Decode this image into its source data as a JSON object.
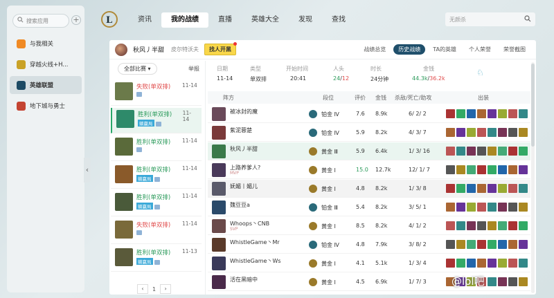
{
  "sidebar": {
    "search_placeholder": "搜索应用",
    "items": [
      {
        "label": "与我相关",
        "icon": "my-related-icon",
        "color": "#f08a24"
      },
      {
        "label": "穿越火线+H...",
        "icon": "crossfire-icon",
        "color": "#c9a227"
      },
      {
        "label": "英雄联盟",
        "icon": "lol-icon",
        "color": "#1c4a64",
        "active": true
      },
      {
        "label": "地下城与勇士",
        "icon": "dnf-icon",
        "color": "#c44432"
      }
    ]
  },
  "topnav": [
    "资讯",
    "我的战绩",
    "直播",
    "英雄大全",
    "发现",
    "查找"
  ],
  "topnav_active": 1,
  "top_search": {
    "placeholder": "无颜杀"
  },
  "profile": {
    "name": "秋风丿半甜",
    "server": "皮尔特沃夫",
    "find_button": "找人开黑",
    "tabs": [
      "战绩总览",
      "历史战绩",
      "TA的英雄",
      "个人荣誉",
      "荣誉截图"
    ],
    "active_tab": 1
  },
  "list": {
    "filter": "全部比赛",
    "sort": "举报",
    "matches": [
      {
        "result": "失败(单双排)",
        "win": false,
        "date": "11-14",
        "tag": "",
        "champ": "#6b7a4a"
      },
      {
        "result": "胜利(单双排)",
        "win": true,
        "date": "11-14",
        "tag": "躺赢局",
        "champ": "#2e8a6a",
        "active": true
      },
      {
        "result": "胜利(单双排)",
        "win": true,
        "date": "11-14",
        "tag": "",
        "champ": "#5a6a3a"
      },
      {
        "result": "胜利(单双排)",
        "win": true,
        "date": "11-14",
        "tag": "躺赢局",
        "champ": "#8a5a2a"
      },
      {
        "result": "胜利(单双排)",
        "win": true,
        "date": "11-14",
        "tag": "躺赢局",
        "champ": "#4a5a3a"
      },
      {
        "result": "失败(单双排)",
        "win": false,
        "date": "11-14",
        "tag": "",
        "champ": "#7a6a3a"
      },
      {
        "result": "胜利(单双排)",
        "win": true,
        "date": "11-13",
        "tag": "躺赢局",
        "champ": "#5a5a3a"
      }
    ],
    "page": "1",
    "prev": "‹",
    "next": "›"
  },
  "summary": {
    "labels": {
      "date": "日期",
      "type": "类型",
      "start": "开始时间",
      "kda": "人头",
      "duration": "时长",
      "gold": "金钱"
    },
    "date": "11-14",
    "type": "单双排",
    "start": "20:41",
    "kda_a": "24",
    "kda_b": "12",
    "duration": "24分钟",
    "gold_a": "44.3k",
    "gold_b": "36.2k",
    "sep": "/"
  },
  "table": {
    "headers": [
      "阵方",
      "段位",
      "评价",
      "金钱",
      "杀敌/死亡/助攻",
      "出装"
    ],
    "rows": [
      {
        "name": "被冰封的魔",
        "rank": "铂金 Ⅳ",
        "score": "7.6",
        "gold": "8.9k",
        "kda": "6/ 2/ 2",
        "ava": "#6a4a5a",
        "rk": "#2a6a7a"
      },
      {
        "name": "紫泥蓉楚",
        "rank": "铂金 Ⅳ",
        "score": "5.9",
        "gold": "8.2k",
        "kda": "4/ 3/ 7",
        "ava": "#7a3a3a",
        "rk": "#2a6a7a"
      },
      {
        "name": "秋风丿半甜",
        "rank": "黄金 Ⅲ",
        "score": "5.9",
        "gold": "6.4k",
        "kda": "1/ 3/ 16",
        "ava": "#3a7a4a",
        "rk": "#9a7a2a",
        "self": true
      },
      {
        "name": "上路养爹人?",
        "rank": "黄金 Ⅰ",
        "score": "15.0",
        "gold": "12.7k",
        "kda": "12/ 1/ 7",
        "ava": "#4a3a5a",
        "rk": "#9a7a2a",
        "sub": "MVP",
        "score_hl": true
      },
      {
        "name": "妩媚丨媚儿",
        "rank": "黄金 Ⅰ",
        "score": "4.8",
        "gold": "8.2k",
        "kda": "1/ 3/ 8",
        "ava": "#5a5a6a",
        "rk": "#9a7a2a",
        "hl": true
      },
      {
        "name": "魏豆豆a",
        "rank": "铂金 Ⅲ",
        "score": "5.4",
        "gold": "8.2k",
        "kda": "3/ 5/ 1",
        "ava": "#2a4a6a",
        "rk": "#2a6a7a"
      },
      {
        "name": "Whoops丶CNB",
        "rank": "黄金 Ⅰ",
        "score": "8.5",
        "gold": "8.2k",
        "kda": "4/ 1/ 2",
        "ava": "#6a4a4a",
        "rk": "#9a7a2a",
        "sub": "SVP"
      },
      {
        "name": "WhistleGame丶Mr",
        "rank": "铂金 Ⅳ",
        "score": "4.8",
        "gold": "7.9k",
        "kda": "3/ 8/ 2",
        "ava": "#5a3a2a",
        "rk": "#2a6a7a"
      },
      {
        "name": "WhistleGame丶Ws",
        "rank": "黄金 Ⅰ",
        "score": "4.1",
        "gold": "5.1k",
        "kda": "1/ 3/ 4",
        "ava": "#3a3a5a",
        "rk": "#9a7a2a"
      },
      {
        "name": "活在黑暗中",
        "rank": "黄金 Ⅰ",
        "score": "4.5",
        "gold": "6.9k",
        "kda": "1/ 7/ 3",
        "ava": "#4a2a4a",
        "rk": "#9a7a2a"
      }
    ]
  },
  "watermark": "@lol吧"
}
